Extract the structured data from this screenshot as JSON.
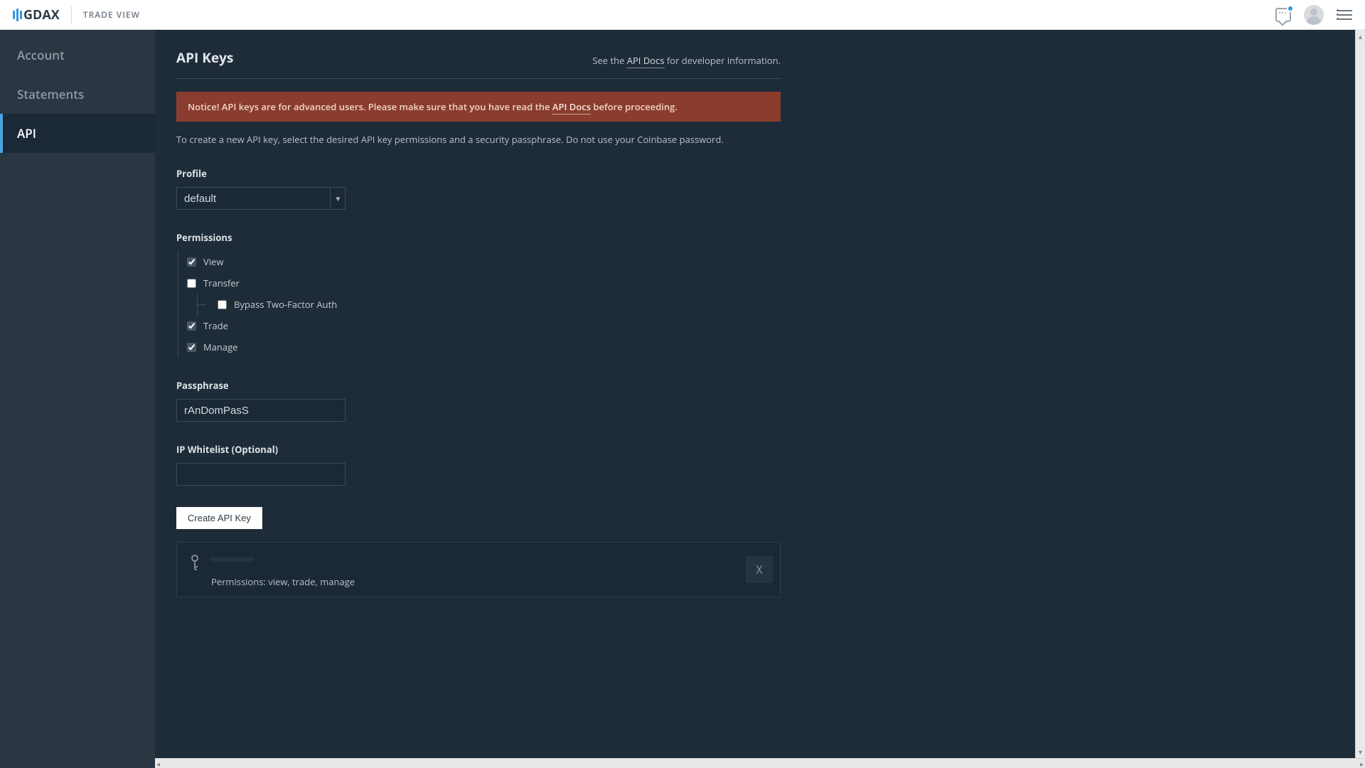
{
  "header": {
    "brand": "GDAX",
    "trade_view": "TRADE VIEW"
  },
  "sidebar": {
    "items": [
      {
        "label": "Account",
        "active": false
      },
      {
        "label": "Statements",
        "active": false
      },
      {
        "label": "API",
        "active": true
      }
    ]
  },
  "page": {
    "title": "API Keys",
    "docs_prefix": "See the ",
    "docs_link": "API Docs",
    "docs_suffix": " for developer information."
  },
  "notice": {
    "before": "Notice! API keys are for advanced users. Please make sure that you have read the ",
    "link": "API Docs",
    "after": " before proceeding."
  },
  "hint": "To create a new API key, select the desired API key permissions and a security passphrase. Do not use your Coinbase password.",
  "form": {
    "profile_label": "Profile",
    "profile_value": "default",
    "permissions_label": "Permissions",
    "permissions": {
      "view": {
        "label": "View",
        "checked": true
      },
      "transfer": {
        "label": "Transfer",
        "checked": false
      },
      "bypass2fa": {
        "label": "Bypass Two-Factor Auth",
        "checked": false
      },
      "trade": {
        "label": "Trade",
        "checked": true
      },
      "manage": {
        "label": "Manage",
        "checked": true
      }
    },
    "passphrase_label": "Passphrase",
    "passphrase_value": "rAnDomPasS",
    "ipwhitelist_label": "IP Whitelist (Optional)",
    "ipwhitelist_value": "",
    "create_button": "Create API Key"
  },
  "existing_key": {
    "masked_name": "•••••••••",
    "permissions_text": "Permissions: view, trade, manage",
    "delete_label": "X"
  }
}
